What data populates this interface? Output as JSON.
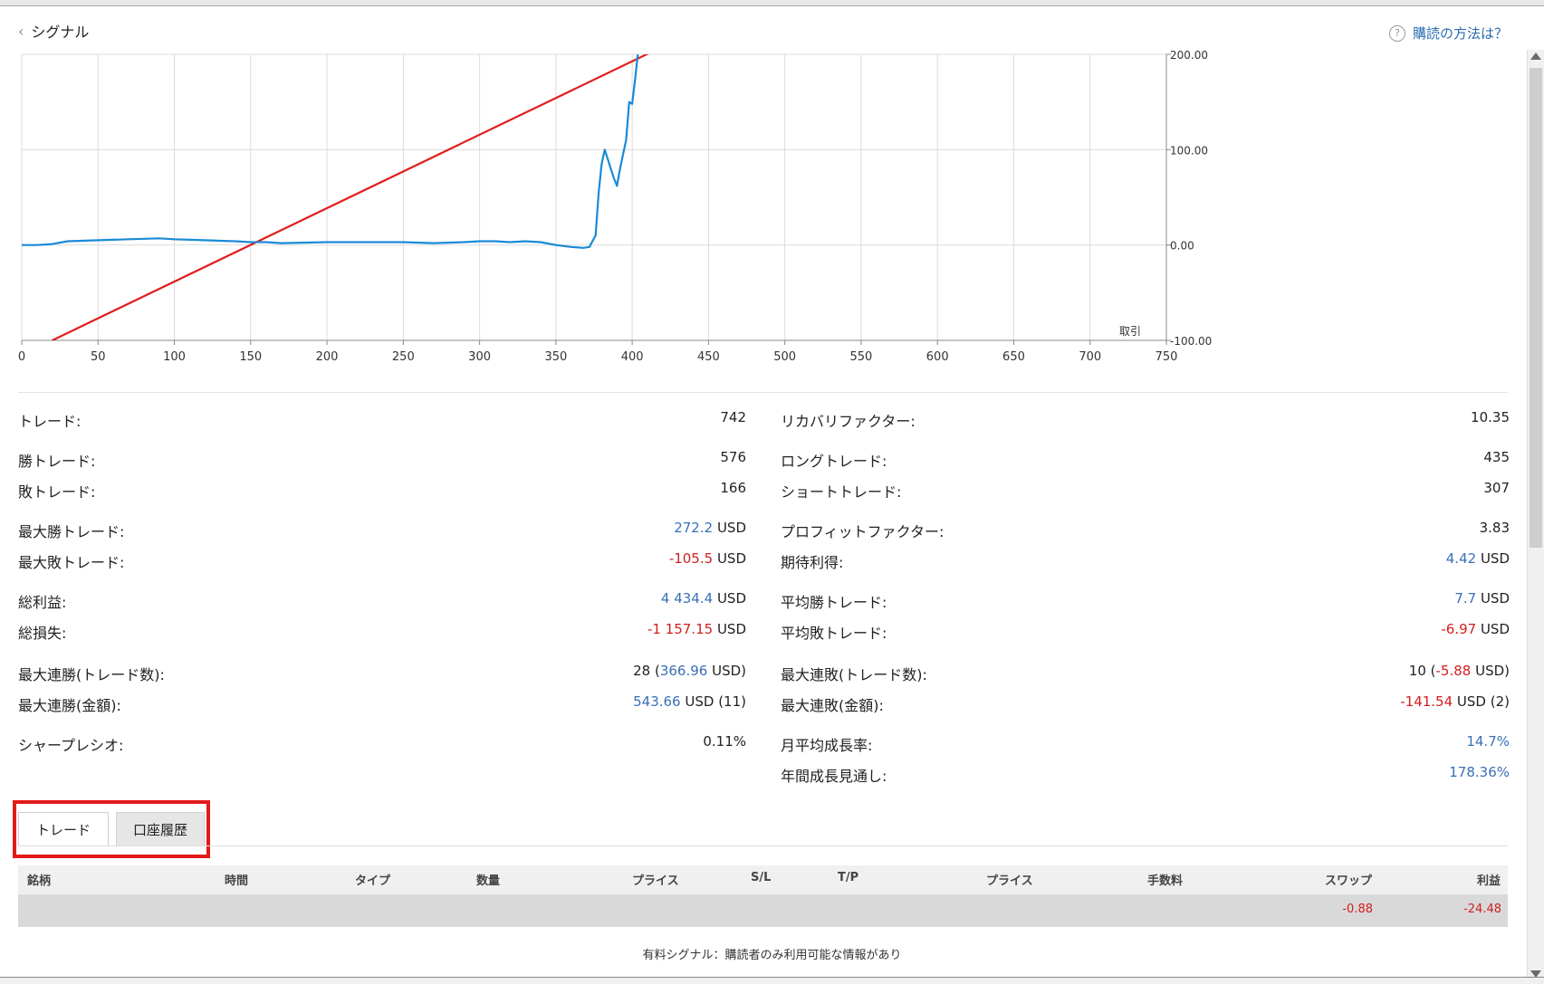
{
  "header": {
    "back_title": "シグナル",
    "help_link": "購読の方法は？"
  },
  "chart_data": {
    "type": "line",
    "x_ticks": [
      "0",
      "50",
      "100",
      "150",
      "200",
      "250",
      "300",
      "350",
      "400",
      "450",
      "500",
      "550",
      "600",
      "650",
      "700",
      "750"
    ],
    "y_ticks": [
      "200.00",
      "100.00",
      "0.00",
      "-100.00"
    ],
    "xlabel": "取引",
    "xlim": [
      0,
      750
    ],
    "ylim": [
      -100,
      200
    ],
    "grid": true,
    "series": [
      {
        "color": "#1a8ad6",
        "points": [
          [
            0,
            0
          ],
          [
            10,
            0
          ],
          [
            20,
            1
          ],
          [
            30,
            4
          ],
          [
            50,
            5
          ],
          [
            70,
            6
          ],
          [
            90,
            7
          ],
          [
            100,
            6
          ],
          [
            120,
            5
          ],
          [
            140,
            4
          ],
          [
            150,
            3
          ],
          [
            160,
            3
          ],
          [
            170,
            2
          ],
          [
            200,
            3
          ],
          [
            230,
            3
          ],
          [
            250,
            3
          ],
          [
            270,
            2
          ],
          [
            290,
            3
          ],
          [
            300,
            4
          ],
          [
            310,
            4
          ],
          [
            320,
            3
          ],
          [
            330,
            4
          ],
          [
            340,
            3
          ],
          [
            350,
            0
          ],
          [
            360,
            -2
          ],
          [
            368,
            -3
          ],
          [
            372,
            -2
          ],
          [
            376,
            10
          ],
          [
            378,
            55
          ],
          [
            380,
            85
          ],
          [
            382,
            100
          ],
          [
            384,
            90
          ],
          [
            386,
            80
          ],
          [
            388,
            70
          ],
          [
            390,
            62
          ],
          [
            392,
            80
          ],
          [
            394,
            95
          ],
          [
            396,
            110
          ],
          [
            398,
            150
          ],
          [
            400,
            148
          ],
          [
            402,
            175
          ],
          [
            404,
            205
          ]
        ]
      },
      {
        "color": "#e01e1e",
        "points": [
          [
            20,
            -100
          ],
          [
            416,
            205
          ]
        ]
      }
    ]
  },
  "stats": {
    "left": [
      {
        "label": "トレード:",
        "value": "742"
      },
      {
        "label": "勝トレード:",
        "value": "576"
      },
      {
        "label": "敗トレード:",
        "value": "166"
      },
      {
        "label": "最大勝トレード:",
        "num": "272.2",
        "unit": " USD"
      },
      {
        "label": "最大敗トレード:",
        "num": "-105.5",
        "unit": " USD"
      },
      {
        "label": "総利益:",
        "num": "4 434.4",
        "unit": " USD"
      },
      {
        "label": "総損失:",
        "num": "-1 157.15",
        "unit": " USD"
      },
      {
        "label": "最大連勝(トレード数):",
        "pre": "28 (",
        "num": "366.96",
        "unit": " USD)"
      },
      {
        "label": "最大連勝(金額):",
        "num": "543.66",
        "unit": " USD (11)"
      },
      {
        "label": "シャープレシオ:",
        "value": "0.11%"
      }
    ],
    "right": [
      {
        "label": "リカバリファクター:",
        "value": "10.35"
      },
      {
        "label": "ロングトレード:",
        "value": "435"
      },
      {
        "label": "ショートトレード:",
        "value": "307"
      },
      {
        "label": "プロフィットファクター:",
        "value": "3.83"
      },
      {
        "label": "期待利得:",
        "num": "4.42",
        "unit": " USD"
      },
      {
        "label": "平均勝トレード:",
        "num": "7.7",
        "unit": " USD"
      },
      {
        "label": "平均敗トレード:",
        "num": "-6.97",
        "unit": " USD"
      },
      {
        "label": "最大連敗(トレード数):",
        "pre": "10 (",
        "num": "-5.88",
        "unit": " USD)"
      },
      {
        "label": "最大連敗(金額):",
        "num": "-141.54",
        "unit": " USD (2)"
      },
      {
        "label": "月平均成長率:",
        "num": "14.7%"
      },
      {
        "label": "年間成長見通し:",
        "num": "178.36%"
      }
    ]
  },
  "tabs": [
    {
      "label": "トレード"
    },
    {
      "label": "口座履歴"
    }
  ],
  "table": {
    "headers": [
      "銘柄",
      "時間",
      "タイプ",
      "数量",
      "プライス",
      "S/L",
      "T/P",
      "プライス",
      "手数料",
      "スワップ",
      "利益"
    ],
    "summary_row": {
      "swap": "-0.88",
      "profit": "-24.48"
    }
  },
  "note": "有料シグナル：購読者のみ利用可能な情報があり",
  "colors": {
    "accent_blue": "#3a6fb7",
    "negative_red": "#d21f1f",
    "highlight_box": "#e21a1a"
  }
}
